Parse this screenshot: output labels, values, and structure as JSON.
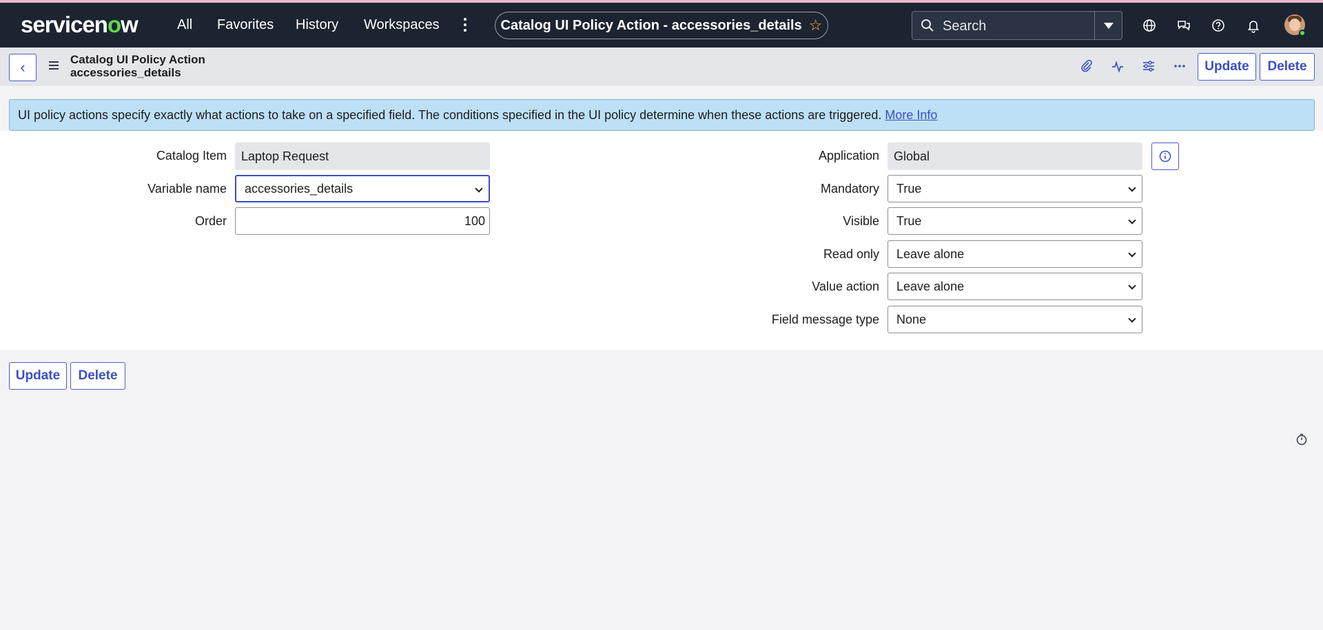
{
  "nav": {
    "logo_pre": "servicen",
    "logo_o": "o",
    "logo_post": "w",
    "links": [
      "All",
      "Favorites",
      "History",
      "Workspaces"
    ],
    "page_title": "Catalog UI Policy Action - accessories_details",
    "search_placeholder": "Search"
  },
  "header": {
    "title_line1": "Catalog UI Policy Action",
    "title_line2": "accessories_details",
    "update_label": "Update",
    "delete_label": "Delete"
  },
  "banner": {
    "text": "UI policy actions specify exactly what actions to take on a specified field. The conditions specified in the UI policy determine when these actions are triggered.",
    "link": "More Info"
  },
  "form": {
    "left": {
      "catalog_item": {
        "label": "Catalog Item",
        "value": "Laptop Request"
      },
      "variable_name": {
        "label": "Variable name",
        "value": "accessories_details"
      },
      "order": {
        "label": "Order",
        "value": "100"
      }
    },
    "right": {
      "application": {
        "label": "Application",
        "value": "Global"
      },
      "mandatory": {
        "label": "Mandatory",
        "value": "True"
      },
      "visible": {
        "label": "Visible",
        "value": "True"
      },
      "read_only": {
        "label": "Read only",
        "value": "Leave alone"
      },
      "value_action": {
        "label": "Value action",
        "value": "Leave alone"
      },
      "field_message_type": {
        "label": "Field message type",
        "value": "None"
      }
    }
  },
  "footer": {
    "update_label": "Update",
    "delete_label": "Delete"
  },
  "icons": {
    "search": "search-icon",
    "globe": "globe-icon",
    "chat": "chat-icon",
    "help": "help-icon",
    "bell": "bell-icon",
    "attachment": "paperclip-icon",
    "activity": "activity-icon",
    "settings": "sliders-icon",
    "more": "more-icon",
    "info": "info-icon",
    "timer": "stopwatch-icon"
  },
  "colors": {
    "nav_bg": "#1c2431",
    "accent": "#3b4ec6",
    "banner_bg": "#bde0f6",
    "logo_green": "#62d84e"
  }
}
